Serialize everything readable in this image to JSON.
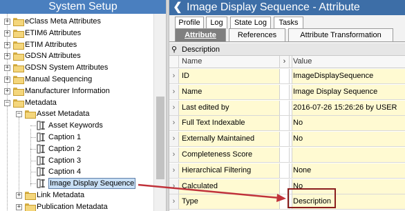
{
  "left_panel": {
    "title": "System Setup",
    "tree": [
      {
        "label": "eClass Meta Attributes",
        "expander": "+"
      },
      {
        "label": "ETIM6 Attributes",
        "expander": "+"
      },
      {
        "label": "ETIM Attributes",
        "expander": "+"
      },
      {
        "label": "GDSN Attributes",
        "expander": "+"
      },
      {
        "label": "GDSN System Attributes",
        "expander": "+"
      },
      {
        "label": "Manual Sequencing",
        "expander": "+"
      },
      {
        "label": "Manufacturer Information",
        "expander": "+"
      },
      {
        "label": "Metadata",
        "expander": "−"
      },
      {
        "label": "Asset Metadata",
        "expander": "−"
      },
      {
        "label": "Asset Keywords",
        "expander": ""
      },
      {
        "label": "Caption 1",
        "expander": ""
      },
      {
        "label": "Caption 2",
        "expander": ""
      },
      {
        "label": "Caption 3",
        "expander": ""
      },
      {
        "label": "Caption 4",
        "expander": ""
      },
      {
        "label": "Image Display Sequence",
        "expander": ""
      },
      {
        "label": "Link Metadata",
        "expander": "+"
      },
      {
        "label": "Publication Metadata",
        "expander": "+"
      }
    ]
  },
  "right_panel": {
    "back_glyph": "❮",
    "title": "Image Display Sequence - Attribute",
    "tabs_row1": [
      "Profile",
      "Log",
      "State Log",
      "Tasks"
    ],
    "tabs_row2": [
      "Attribute",
      "References",
      "Attribute Transformation"
    ],
    "section_pin": "⚲",
    "section_label": "Description",
    "columns": {
      "name": "Name",
      "value": "Value",
      "sort_glyph": "›"
    },
    "row_glyph": "›",
    "rows": [
      {
        "name": "ID",
        "value": "ImageDisplaySequence"
      },
      {
        "name": "Name",
        "value": "Image Display Sequence"
      },
      {
        "name": "Last edited by",
        "value": "2016-07-26 15:26:26 by USER"
      },
      {
        "name": "Full Text Indexable",
        "value": "No"
      },
      {
        "name": "Externally Maintained",
        "value": "No"
      },
      {
        "name": "Completeness Score",
        "value": ""
      },
      {
        "name": "Hierarchical Filtering",
        "value": "None"
      },
      {
        "name": "Calculated",
        "value": "No"
      },
      {
        "name": "Type",
        "value": "Description"
      }
    ]
  },
  "colors": {
    "left_header": "#4a7fbf",
    "right_header": "#3d6ea7",
    "cell_yellow": "#fffad2",
    "annotation_red": "#8a1c1c",
    "active_tab": "#7f7f7f"
  }
}
